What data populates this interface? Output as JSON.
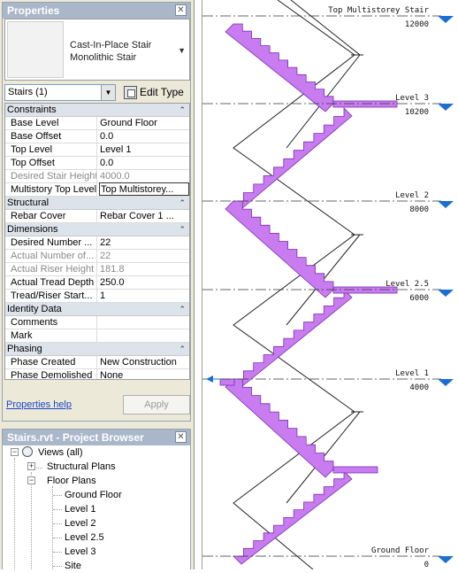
{
  "properties": {
    "title": "Properties",
    "type_line1": "Cast-In-Place Stair",
    "type_line2": "Monolithic Stair",
    "instance_filter": "Stairs (1)",
    "edit_type_label": "Edit Type",
    "help_label": "Properties help",
    "apply_label": "Apply",
    "groups": [
      {
        "name": "Constraints",
        "rows": [
          {
            "name": "Base Level",
            "value": "Ground Floor",
            "dim": false
          },
          {
            "name": "Base Offset",
            "value": "0.0",
            "dim": false
          },
          {
            "name": "Top Level",
            "value": "Level 1",
            "dim": false
          },
          {
            "name": "Top Offset",
            "value": "0.0",
            "dim": false
          },
          {
            "name": "Desired Stair Height",
            "value": "4000.0",
            "dim": true
          },
          {
            "name": "Multistory Top Level",
            "value": "Top Multistorey...",
            "dim": false,
            "active": true
          }
        ]
      },
      {
        "name": "Structural",
        "rows": [
          {
            "name": "Rebar Cover",
            "value": "Rebar Cover 1 ...",
            "dim": false
          }
        ]
      },
      {
        "name": "Dimensions",
        "rows": [
          {
            "name": "Desired Number ...",
            "value": "22",
            "dim": false
          },
          {
            "name": "Actual Number of...",
            "value": "22",
            "dim": true
          },
          {
            "name": "Actual Riser Height",
            "value": "181.8",
            "dim": true
          },
          {
            "name": "Actual Tread Depth",
            "value": "250.0",
            "dim": false
          },
          {
            "name": "Tread/Riser Start...",
            "value": "1",
            "dim": false
          }
        ]
      },
      {
        "name": "Identity Data",
        "rows": [
          {
            "name": "Comments",
            "value": "",
            "dim": false
          },
          {
            "name": "Mark",
            "value": "",
            "dim": false
          }
        ]
      },
      {
        "name": "Phasing",
        "rows": [
          {
            "name": "Phase Created",
            "value": "New Construction",
            "dim": false
          },
          {
            "name": "Phase Demolished",
            "value": "None",
            "dim": false
          }
        ]
      }
    ]
  },
  "browser": {
    "title": "Stairs.rvt - Project Browser",
    "root_label": "Views (all)",
    "structural_plans_label": "Structural Plans",
    "floor_plans_label": "Floor Plans",
    "floor_plans": [
      "Ground Floor",
      "Level 1",
      "Level 2",
      "Level 2.5",
      "Level 3",
      "Site"
    ]
  },
  "levels": [
    {
      "name": "Top Multistorey Stair",
      "elevation": "12000"
    },
    {
      "name": "Level 3",
      "elevation": "10200"
    },
    {
      "name": "Level 2",
      "elevation": "8000"
    },
    {
      "name": "Level 2.5",
      "elevation": "6000"
    },
    {
      "name": "Level 1",
      "elevation": "4000"
    },
    {
      "name": "Ground Floor",
      "elevation": "0"
    }
  ],
  "colors": {
    "stair_fill": "#c87cf0",
    "stair_edge": "#7a2fb3",
    "level_marker": "#1b6fd1",
    "panel_title": "#a9b7c9"
  }
}
